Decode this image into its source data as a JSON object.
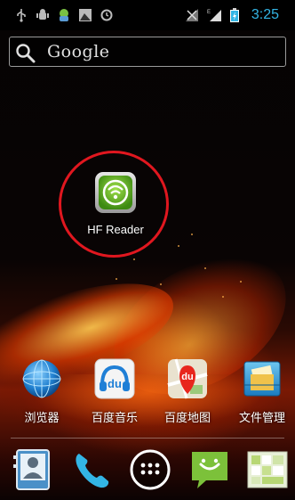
{
  "status_bar": {
    "time": "3:25",
    "left_icons": [
      "usb-icon",
      "android-debug-icon",
      "android-notification-icon",
      "photo-notification-icon",
      "alarm-notification-icon"
    ],
    "right_icons": [
      "no-signal-icon",
      "signal-strength-icon",
      "battery-charging-icon"
    ],
    "accent_color": "#33b5e5"
  },
  "search": {
    "label": "Google"
  },
  "apps": {
    "hf_reader": {
      "label": "HF Reader"
    },
    "browser": {
      "label": "浏览器"
    },
    "baidu_music": {
      "label": "百度音乐",
      "icon_text": "du"
    },
    "baidu_map": {
      "label": "百度地图",
      "icon_text": "du"
    },
    "file_manager": {
      "label": "文件管理"
    }
  },
  "hotseat": [
    "contacts-icon",
    "phone-icon",
    "app-drawer-icon",
    "messaging-icon",
    "gallery-icon"
  ],
  "highlight_color": "#e0171f"
}
